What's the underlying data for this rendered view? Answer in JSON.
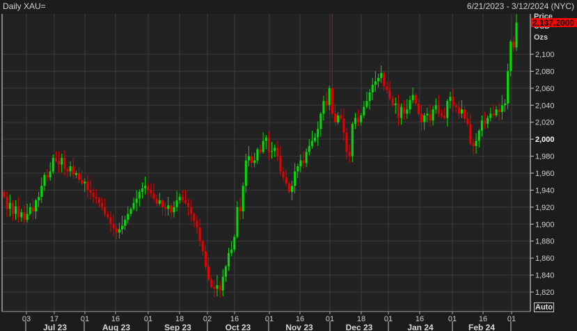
{
  "header": {
    "title": "Daily XAU=",
    "range": "6/21/2023 - 3/12/2024 (NYC)"
  },
  "axis_header": {
    "price": "Price",
    "currency": "USD",
    "unit": "Ozs"
  },
  "last_price": "2,137.2000",
  "auto_button": "Auto",
  "colors": {
    "up": "#00e000",
    "down": "#e80000",
    "grid": "#3a3a3a",
    "plot_bg": "#222222"
  },
  "chart_data": {
    "type": "candlestick",
    "title": "Daily XAU=",
    "ylabel": "Price USD Ozs",
    "ylim": [
      1808,
      2160
    ],
    "yticks": [
      1820,
      1840,
      1860,
      1880,
      1900,
      1920,
      1940,
      1960,
      1980,
      2000,
      2020,
      2040,
      2060,
      2080,
      2100
    ],
    "ytick_labels": [
      "1,820",
      "1,840",
      "1,860",
      "1,880",
      "1,900",
      "1,920",
      "1,940",
      "1,960",
      "1,980",
      "2,000",
      "2,020",
      "2,040",
      "2,060",
      "2,080",
      "2,100"
    ],
    "xtick_labels": [
      "03",
      "17",
      "01",
      "16",
      "01",
      "18",
      "02",
      "16",
      "01",
      "16",
      "01",
      "18",
      "01",
      "16",
      "01",
      "16",
      "01"
    ],
    "month_labels": [
      "Jul 23",
      "Aug 23",
      "Sep 23",
      "Oct 23",
      "Nov 23",
      "Dec 23",
      "Jan 24",
      "Feb 24"
    ],
    "first_open": 1938,
    "closes": [
      1932,
      1918,
      1925,
      1912,
      1921,
      1908,
      1914,
      1905,
      1912,
      1920,
      1915,
      1928,
      1932,
      1945,
      1958,
      1955,
      1962,
      1978,
      1974,
      1970,
      1978,
      1965,
      1962,
      1968,
      1958,
      1960,
      1952,
      1948,
      1950,
      1940,
      1937,
      1932,
      1930,
      1925,
      1920,
      1912,
      1908,
      1900,
      1895,
      1890,
      1894,
      1898,
      1905,
      1912,
      1918,
      1925,
      1930,
      1938,
      1942,
      1945,
      1940,
      1936,
      1930,
      1924,
      1928,
      1920,
      1918,
      1922,
      1914,
      1920,
      1928,
      1932,
      1928,
      1925,
      1920,
      1912,
      1904,
      1896,
      1880,
      1868,
      1850,
      1835,
      1826,
      1824,
      1828,
      1822,
      1838,
      1850,
      1866,
      1870,
      1885,
      1920,
      1915,
      1945,
      1975,
      1980,
      1972,
      1975,
      1988,
      1985,
      1998,
      2002,
      1985,
      1986,
      1990,
      1980,
      1962,
      1955,
      1948,
      1938,
      1945,
      1962,
      1968,
      1975,
      1972,
      1985,
      1992,
      1998,
      2002,
      2012,
      2030,
      2045,
      2040,
      2060,
      2030,
      2020,
      2028,
      2024,
      2008,
      1985,
      1980,
      2018,
      2025,
      2020,
      2028,
      2038,
      2045,
      2055,
      2064,
      2068,
      2072,
      2078,
      2062,
      2058,
      2048,
      2040,
      2042,
      2025,
      2038,
      2030,
      2035,
      2046,
      2052,
      2042,
      2030,
      2020,
      2028,
      2030,
      2022,
      2035,
      2040,
      2030,
      2028,
      2025,
      2045,
      2050,
      2040,
      2038,
      2030,
      2035,
      2024,
      2018,
      1995,
      1992,
      1998,
      2010,
      2022,
      2018,
      2025,
      2030,
      2028,
      2035,
      2032,
      2040,
      2042,
      2080,
      2115,
      2108,
      2137.2
    ],
    "high_overrides": {
      "114": 2148
    }
  }
}
